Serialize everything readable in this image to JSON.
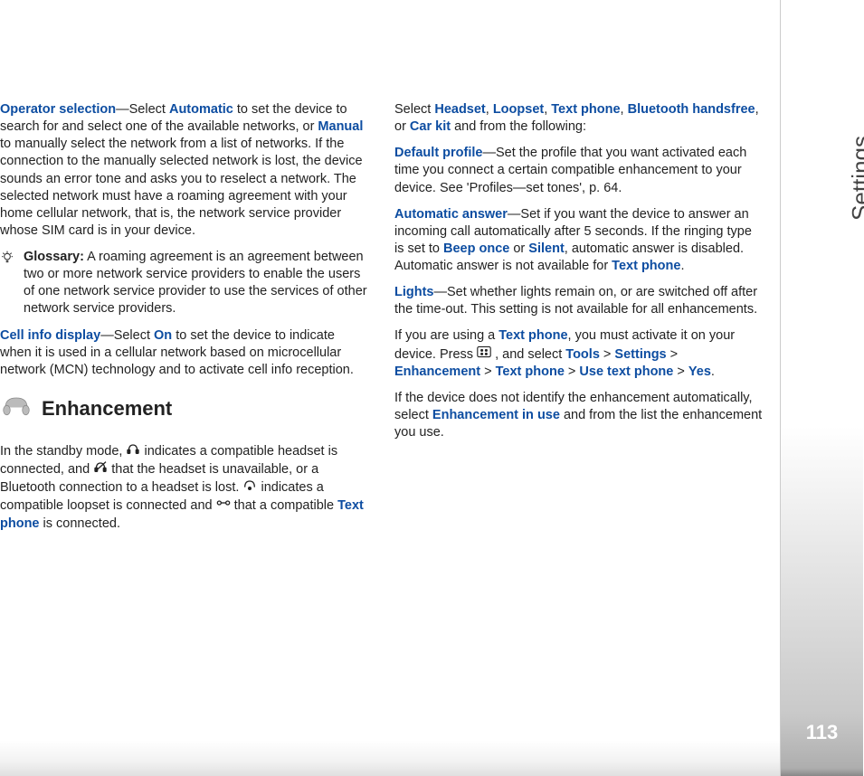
{
  "sidebar": {
    "section": "Settings",
    "page": "113"
  },
  "left": {
    "operator": {
      "term": "Operator selection",
      "t1": "—Select ",
      "r1": "Automatic",
      "t2": " to set the device to search for and select one of the available networks, or ",
      "r2": "Manual",
      "t3": " to manually select the network from a list of networks. If the connection to the manually selected network is lost, the device sounds an error tone and asks you to reselect a network. The selected network must have a roaming agreement with your home cellular network, that is, the network service provider whose SIM card is in your device."
    },
    "glossary": {
      "label": "Glossary:",
      "text": " A roaming agreement is an agreement between two or more network service providers to enable the users of one network service provider to use the services of other network service providers."
    },
    "cellinfo": {
      "term": "Cell info display",
      "t1": "—Select ",
      "r1": "On",
      "t2": " to set the device to indicate when it is used in a cellular network based on microcellular network (MCN) technology and to activate cell info reception."
    },
    "enhHeading": "Enhancement",
    "standby": {
      "a": "In the standby mode, ",
      "b": " indicates a compatible headset is connected, and ",
      "c": " that the headset is unavailable, or a Bluetooth connection to a headset is lost. ",
      "d": " indicates a compatible loopset is connected and ",
      "e": " that a compatible ",
      "r1": "Text phone",
      "f": " is connected."
    }
  },
  "right": {
    "selectLine": {
      "a": "Select ",
      "r1": "Headset",
      "s1": ", ",
      "r2": "Loopset",
      "s2": ", ",
      "r3": "Text phone",
      "s3": ", ",
      "r4": "Bluetooth handsfree",
      "s4": ", or ",
      "r5": "Car kit",
      "b": " and from the following:"
    },
    "defaultProfile": {
      "term": "Default profile",
      "text": "—Set the profile that you want activated each time you connect a certain compatible enhancement to your device. See 'Profiles—set tones', p. 64."
    },
    "autoAnswer": {
      "term": "Automatic answer",
      "a": "—Set if you want the device to answer an incoming call automatically after 5 seconds. If the ringing type is set to ",
      "r1": "Beep once",
      "b": " or ",
      "r2": "Silent",
      "c": ", automatic answer is disabled. Automatic answer is not available for ",
      "r3": "Text phone",
      "d": "."
    },
    "lights": {
      "term": "Lights",
      "text": "—Set whether lights remain on, or are switched off after the time-out. This setting is not available for all enhancements."
    },
    "textPhone": {
      "a": "If you are using a ",
      "r1": "Text phone",
      "b": ", you must activate it on your device. Press ",
      "c": " , and select ",
      "r2": "Tools",
      "g1": " > ",
      "r3": "Settings",
      "g2": " > ",
      "r4": "Enhancement",
      "g3": " > ",
      "r5": "Text phone",
      "g4": " > ",
      "r6": "Use text phone",
      "g5": " > ",
      "r7": "Yes",
      "d": "."
    },
    "notIdentify": {
      "a": "If the device does not identify the enhancement automatically, select ",
      "r1": "Enhancement in use",
      "b": " and from the list the enhancement you use."
    }
  }
}
